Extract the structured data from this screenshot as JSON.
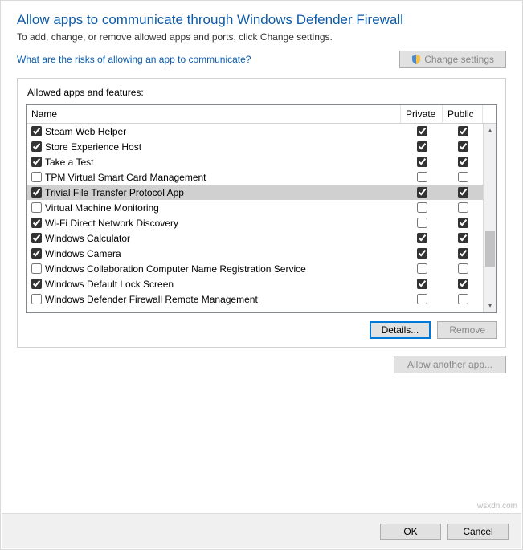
{
  "header": {
    "title": "Allow apps to communicate through Windows Defender Firewall",
    "subtitle": "To add, change, or remove allowed apps and ports, click Change settings.",
    "risk_link": "What are the risks of allowing an app to communicate?",
    "change_settings": "Change settings"
  },
  "group": {
    "label": "Allowed apps and features:",
    "columns": {
      "name": "Name",
      "private": "Private",
      "public": "Public"
    },
    "rows": [
      {
        "name": "Steam Web Helper",
        "enabled": true,
        "private": true,
        "public": true,
        "selected": false
      },
      {
        "name": "Store Experience Host",
        "enabled": true,
        "private": true,
        "public": true,
        "selected": false
      },
      {
        "name": "Take a Test",
        "enabled": true,
        "private": true,
        "public": true,
        "selected": false
      },
      {
        "name": "TPM Virtual Smart Card Management",
        "enabled": false,
        "private": false,
        "public": false,
        "selected": false
      },
      {
        "name": "Trivial File Transfer Protocol App",
        "enabled": true,
        "private": true,
        "public": true,
        "selected": true
      },
      {
        "name": "Virtual Machine Monitoring",
        "enabled": false,
        "private": false,
        "public": false,
        "selected": false
      },
      {
        "name": "Wi-Fi Direct Network Discovery",
        "enabled": true,
        "private": false,
        "public": true,
        "selected": false
      },
      {
        "name": "Windows Calculator",
        "enabled": true,
        "private": true,
        "public": true,
        "selected": false
      },
      {
        "name": "Windows Camera",
        "enabled": true,
        "private": true,
        "public": true,
        "selected": false
      },
      {
        "name": "Windows Collaboration Computer Name Registration Service",
        "enabled": false,
        "private": false,
        "public": false,
        "selected": false
      },
      {
        "name": "Windows Default Lock Screen",
        "enabled": true,
        "private": true,
        "public": true,
        "selected": false
      },
      {
        "name": "Windows Defender Firewall Remote Management",
        "enabled": false,
        "private": false,
        "public": false,
        "selected": false
      }
    ],
    "details_btn": "Details...",
    "remove_btn": "Remove"
  },
  "another_btn": "Allow another app...",
  "footer": {
    "ok": "OK",
    "cancel": "Cancel"
  },
  "credit": "wsxdn.com"
}
